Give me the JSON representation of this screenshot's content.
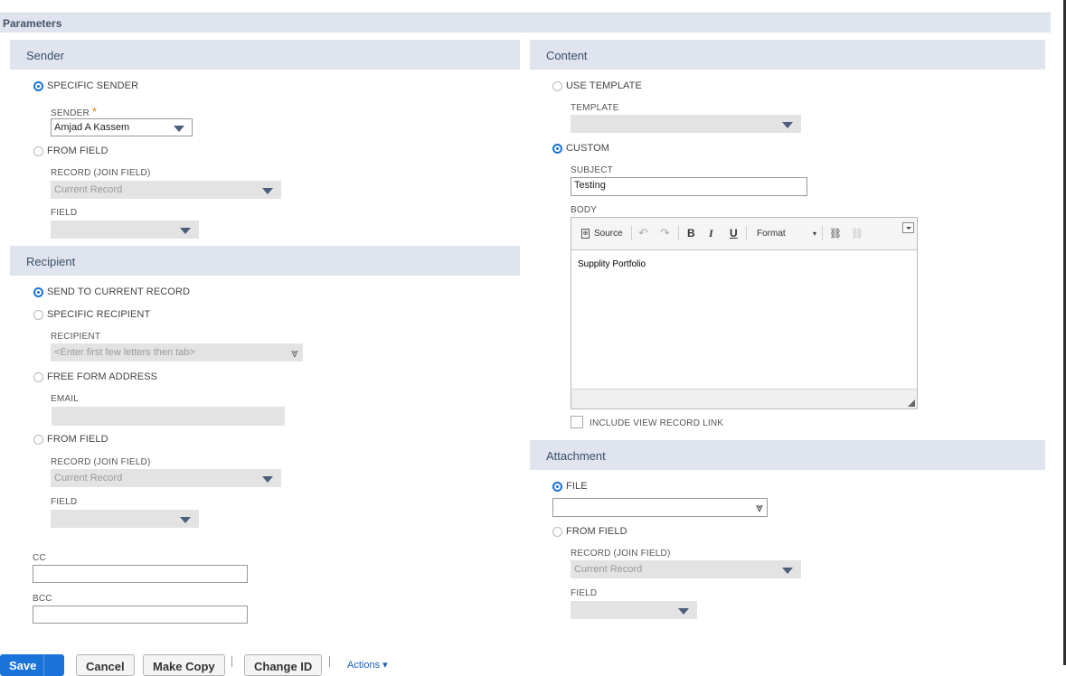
{
  "header": {
    "title": "Parameters"
  },
  "sender": {
    "section_title": "Sender",
    "specific_sender_label": "SPECIFIC SENDER",
    "sender_field_label": "SENDER",
    "sender_required_mark": "*",
    "sender_value": "Amjad A Kassem",
    "from_field_label": "FROM FIELD",
    "record_join_label": "RECORD (JOIN FIELD)",
    "record_join_value": "Current Record",
    "field_label": "FIELD",
    "field_value": ""
  },
  "recipient": {
    "section_title": "Recipient",
    "send_current_label": "SEND TO CURRENT RECORD",
    "specific_recipient_label": "SPECIFIC RECIPIENT",
    "recipient_field_label": "RECIPIENT",
    "recipient_placeholder": "<Enter first few letters then tab>",
    "free_form_label": "FREE FORM ADDRESS",
    "email_label": "EMAIL",
    "email_value": "",
    "from_field_label": "FROM FIELD",
    "record_join_label": "RECORD (JOIN FIELD)",
    "record_join_value": "Current Record",
    "field_label": "FIELD",
    "field_value": "",
    "cc_label": "CC",
    "cc_value": "",
    "bcc_label": "BCC",
    "bcc_value": ""
  },
  "content": {
    "section_title": "Content",
    "use_template_label": "USE TEMPLATE",
    "template_label": "TEMPLATE",
    "template_value": "",
    "custom_label": "CUSTOM",
    "subject_label": "SUBJECT",
    "subject_value": "Testing",
    "body_label": "BODY",
    "toolbar": {
      "source_label": "Source",
      "bold": "B",
      "italic": "I",
      "underline": "U",
      "format_label": "Format"
    },
    "body_text": "Supplity Portfolio",
    "include_link_label": "INCLUDE VIEW RECORD LINK"
  },
  "attachment": {
    "section_title": "Attachment",
    "file_label": "FILE",
    "file_value": "",
    "from_field_label": "FROM FIELD",
    "record_join_label": "RECORD (JOIN FIELD)",
    "record_join_value": "Current Record",
    "field_label": "FIELD",
    "field_value": ""
  },
  "footer": {
    "save_label": "Save",
    "cancel_label": "Cancel",
    "make_copy_label": "Make Copy",
    "change_id_label": "Change ID",
    "actions_label": "Actions ▾"
  },
  "colors": {
    "section_bg": "#dfe4ee",
    "accent": "#1a73d9",
    "required": "#e07b00"
  }
}
